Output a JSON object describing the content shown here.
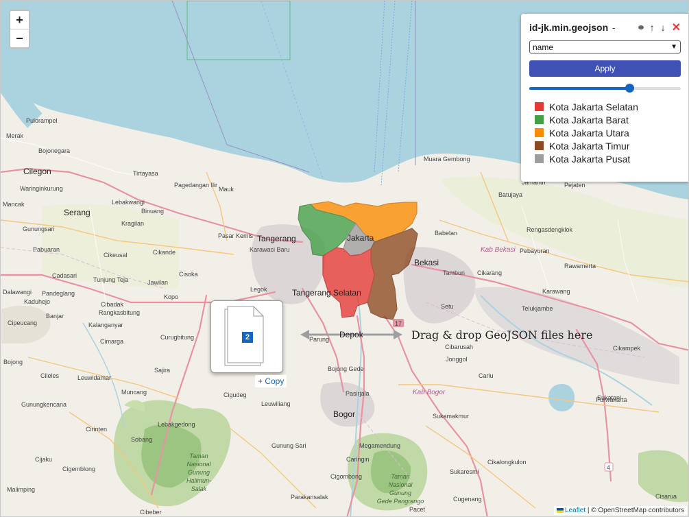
{
  "zoom": {
    "in_label": "+",
    "out_label": "−"
  },
  "panel": {
    "title": "id-jk.min.geojson",
    "dash": "-",
    "up_icon_glyph": "↑",
    "down_icon_glyph": "↓",
    "close_icon_glyph": "✕",
    "select_value": "name",
    "apply_label": "Apply",
    "opacity_value": 0.66,
    "legend": [
      {
        "label": "Kota Jakarta Selatan",
        "color": "#e53935"
      },
      {
        "label": "Kota Jakarta Barat",
        "color": "#43a047"
      },
      {
        "label": "Kota Jakarta Utara",
        "color": "#fb8c00"
      },
      {
        "label": "Kota Jakarta Timur",
        "color": "#8d4a21"
      },
      {
        "label": "Kota Jakarta Pusat",
        "color": "#9e9e9e"
      }
    ]
  },
  "drag": {
    "badge": "2",
    "copy_label": "Copy",
    "drop_text": "Drag & drop GeoJSON files here"
  },
  "attribution": {
    "leaflet": "Leaflet",
    "osm": "| © OpenStreetMap contributors"
  },
  "places": [
    "Pulorampel",
    "Merak",
    "Bojonegara",
    "Cilegon",
    "Waringinkurung",
    "Mancak",
    "Serang",
    "Gunungsari",
    "Pabuaran",
    "Cadasari",
    "Dalawangi",
    "Kaduhejo",
    "Banjar",
    "Cipeucang",
    "Bojong",
    "Cileles",
    "Gunungkencana",
    "Cijaku",
    "Malimping",
    "Cibeber",
    "Tirtayasa",
    "Pagedangan Ilir",
    "Mauk",
    "Lebakwangi",
    "Binuang",
    "Kragilan",
    "Cikeusal",
    "Tunjung Teja",
    "Jawilan",
    "Kopo",
    "Pandeglang",
    "Cibadak",
    "Rangkasbitung",
    "Kalanganyar",
    "Cimarga",
    "Curugbitung",
    "Sajira",
    "Leuwidamar",
    "Muncang",
    "Sobang",
    "Cirinten",
    "Cigemblong",
    "Lebakgedong",
    "Pasar Kemis",
    "Karawaci Baru",
    "Cikande",
    "Cisoka",
    "Legok",
    "Tangerang",
    "Tangerang Selatan",
    "Parung",
    "Bojong Gede",
    "Cigudeg",
    "Leuwiliang",
    "Pasirjala",
    "Bogor",
    "Gunung Sari",
    "Megamendung",
    "Caringin",
    "Cigombong",
    "Parakansalak",
    "Jakarta",
    "Muara Gembong",
    "Babelan",
    "Bekasi",
    "Tambun",
    "Cikarang",
    "Setu",
    "Cibarusah",
    "Jonggol",
    "Cariu",
    "Sukamakmur",
    "Sukaresmi",
    "Cikalongkulon",
    "Cugenang",
    "Pacet",
    "Batujaya",
    "Jamantri",
    "Pejaten",
    "Rengasdengklok",
    "Pebayuran",
    "Rawamerta",
    "Karawang",
    "Telukjambe",
    "Cikampek",
    "Purwakarta",
    "Sukatani",
    "Cisarua",
    "Depok"
  ],
  "parks": [
    "Taman Nasional Gunung Halimun-Salak",
    "Taman Nasional Gunung Gede Pangrango"
  ],
  "areas": [
    "Kab Bekasi",
    "Kab Bogor"
  ],
  "route_shields": [
    "17",
    "4"
  ]
}
